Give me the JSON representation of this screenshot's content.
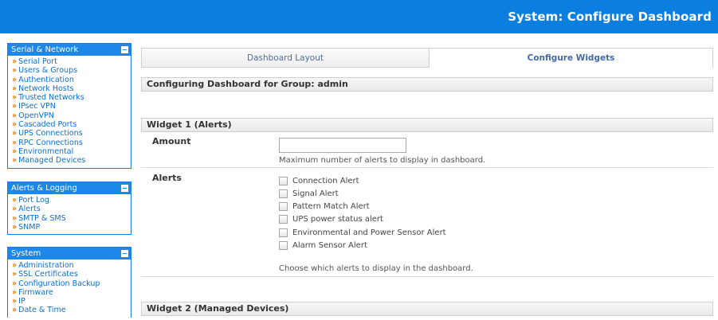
{
  "header": {
    "title": "System: Configure Dashboard"
  },
  "sidebar": {
    "panels": [
      {
        "title": "Serial & Network",
        "items": [
          "Serial Port",
          "Users & Groups",
          "Authentication",
          "Network Hosts",
          "Trusted Networks",
          "IPsec VPN",
          "OpenVPN",
          "Cascaded Ports",
          "UPS Connections",
          "RPC Connections",
          "Environmental",
          "Managed Devices"
        ]
      },
      {
        "title": "Alerts & Logging",
        "items": [
          "Port Log",
          "Alerts",
          "SMTP & SMS",
          "SNMP"
        ]
      },
      {
        "title": "System",
        "items": [
          "Administration",
          "SSL Certificates",
          "Configuration Backup",
          "Firmware",
          "IP",
          "Date & Time"
        ]
      }
    ]
  },
  "tabs": {
    "layout": "Dashboard Layout",
    "widgets": "Configure Widgets"
  },
  "group_bar": "Configuring Dashboard for Group: admin",
  "widget1": {
    "title": "Widget 1 (Alerts)",
    "amount_label": "Amount",
    "amount_value": "",
    "amount_help": "Maximum number of alerts to display in dashboard.",
    "alerts_label": "Alerts",
    "options": [
      "Connection Alert",
      "Signal Alert",
      "Pattern Match Alert",
      "UPS power status alert",
      "Environmental and Power Sensor Alert",
      "Alarm Sensor Alert"
    ],
    "alerts_help": "Choose which alerts to display in the dashboard."
  },
  "widget2": {
    "title": "Widget 2 (Managed Devices)"
  },
  "colors": {
    "accent": "#0a7fe0",
    "link": "#0e6fd6",
    "bullet": "#e07a00"
  },
  "icons": {
    "bullet": "»",
    "panel_toggle": "minus-icon"
  }
}
